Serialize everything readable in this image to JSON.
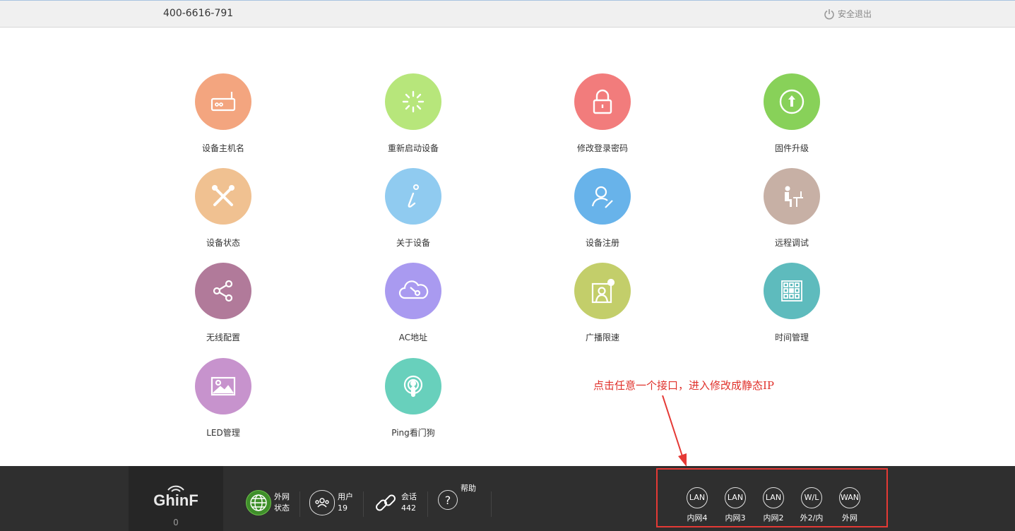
{
  "header": {
    "phone": "400-6616-791",
    "logout_label": "安全退出"
  },
  "tiles": [
    {
      "label": "设备主机名",
      "color": "#f3a57f",
      "icon": "router-icon"
    },
    {
      "label": "重新启动设备",
      "color": "#b7e67b",
      "icon": "spinner-icon"
    },
    {
      "label": "修改登录密码",
      "color": "#f27c7c",
      "icon": "lock-icon"
    },
    {
      "label": "固件升级",
      "color": "#88d159",
      "icon": "upgrade-icon"
    },
    {
      "label": "设备状态",
      "color": "#f0c191",
      "icon": "tools-icon"
    },
    {
      "label": "关于设备",
      "color": "#90cbf0",
      "icon": "info-icon"
    },
    {
      "label": "设备注册",
      "color": "#68b3ea",
      "icon": "user-edit-icon"
    },
    {
      "label": "远程调试",
      "color": "#c7b0a5",
      "icon": "remote-icon"
    },
    {
      "label": "无线配置",
      "color": "#b17a9a",
      "icon": "share-icon"
    },
    {
      "label": "AC地址",
      "color": "#a99af0",
      "icon": "cloud-key-icon"
    },
    {
      "label": "广播限速",
      "color": "#c3ce6a",
      "icon": "broadcast-icon"
    },
    {
      "label": "时间管理",
      "color": "#5ebbbd",
      "icon": "grid-icon"
    },
    {
      "label": "LED管理",
      "color": "#c793cd",
      "icon": "image-icon"
    },
    {
      "label": "Ping看门狗",
      "color": "#68d0bc",
      "icon": "podcast-icon"
    }
  ],
  "annotation": "点击任意一个接口，进入修改成静态IP",
  "footer": {
    "logo": "GhinF",
    "logo_count": "0",
    "wan_status": {
      "line1": "外网",
      "line2": "状态"
    },
    "users": {
      "label": "用户",
      "count": "19"
    },
    "sessions": {
      "label": "会话",
      "count": "442"
    },
    "help": {
      "label": "帮助"
    }
  },
  "ports": [
    {
      "tag": "LAN",
      "label": "内网4"
    },
    {
      "tag": "LAN",
      "label": "内网3"
    },
    {
      "tag": "LAN",
      "label": "内网2"
    },
    {
      "tag": "W/L",
      "label": "外2/内"
    },
    {
      "tag": "WAN",
      "label": "外网"
    }
  ]
}
